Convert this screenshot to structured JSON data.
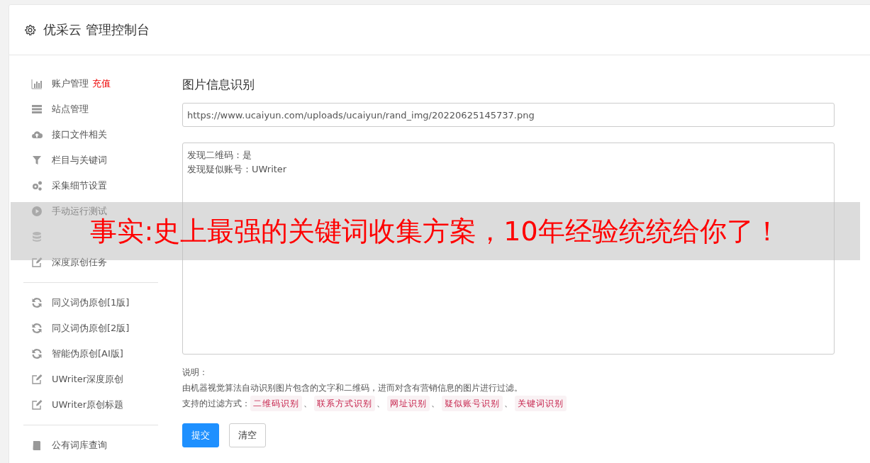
{
  "header": {
    "title": "优采云 管理控制台"
  },
  "sidebar": {
    "groups": [
      {
        "items": [
          {
            "label": "账户管理",
            "badge": "充值"
          },
          {
            "label": "站点管理"
          },
          {
            "label": "接口文件相关"
          },
          {
            "label": "栏目与关键词"
          },
          {
            "label": "采集细节设置"
          },
          {
            "label": "手动运行测试"
          },
          {
            "kind": "icon_only"
          },
          {
            "label": "深度原创任务"
          }
        ]
      },
      {
        "items": [
          {
            "label": "同义词伪原创[1版]"
          },
          {
            "label": "同义词伪原创[2版]"
          },
          {
            "label": "智能伪原创[AI版]"
          },
          {
            "label": "UWriter深度原创"
          },
          {
            "label": "UWriter原创标题"
          }
        ]
      },
      {
        "items": [
          {
            "label": "公有词库查询"
          }
        ]
      }
    ]
  },
  "main": {
    "title": "图片信息识别",
    "url_field": {
      "value": "https://www.ucaiyun.com/uploads/ucaiyun/rand_img/20220625145737.png"
    },
    "result_box": {
      "lines": [
        "发现二维码：是",
        "发现疑似账号：UWriter"
      ]
    },
    "note_label": "说明：",
    "note_text": "由机器视觉算法自动识别图片包含的文字和二维码，进而对含有营销信息的图片进行过滤。",
    "filters_label": "支持的过滤方式：",
    "filters": [
      "二维码识别",
      "联系方式识别",
      "网址识别",
      "疑似账号识别",
      "关键词识别"
    ],
    "separator": "、",
    "buttons": [
      {
        "label": "提交",
        "kind": "primary"
      },
      {
        "label": "清空",
        "kind": "default"
      }
    ]
  },
  "banner": {
    "text": "事实:史上最强的关键词收集方案，10年经验统统给你了！"
  }
}
